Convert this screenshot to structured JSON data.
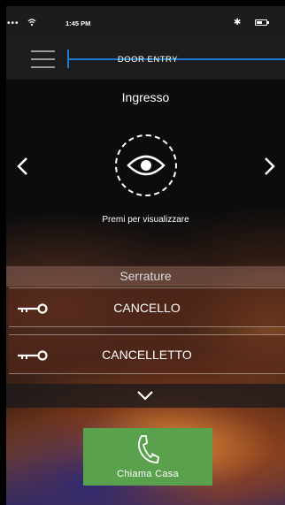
{
  "status_bar": {
    "signal_dots": "•••",
    "time": "1:45 PM",
    "bluetooth_icon": "bluetooth-icon",
    "battery_icon": "battery-icon"
  },
  "header": {
    "title": "DOOR ENTRY",
    "accent_color": "#1e7bd2"
  },
  "camera": {
    "name": "Ingresso",
    "view_hint": "Premi per visualizzare"
  },
  "locks": {
    "section_title": "Serrature",
    "items": [
      {
        "label": "CANCELLO",
        "icon": "key-icon"
      },
      {
        "label": "CANCELLETTO",
        "icon": "key-icon"
      }
    ]
  },
  "call": {
    "label": "Chiama Casa",
    "color": "#5aa14d"
  }
}
